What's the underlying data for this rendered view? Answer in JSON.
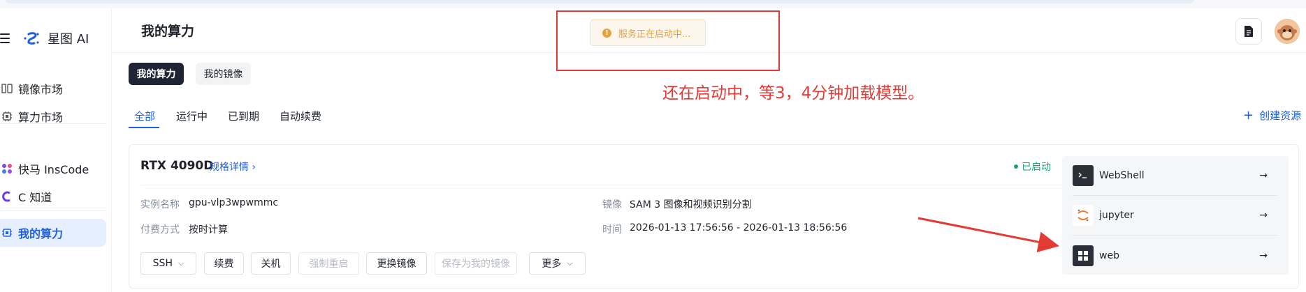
{
  "brand": {
    "name": "星图 AI"
  },
  "sidebar": {
    "items": [
      {
        "label": "镜像市场",
        "icon": "image-market-icon"
      },
      {
        "label": "算力市场",
        "icon": "compute-market-icon"
      },
      {
        "label": "快马 InsCode",
        "icon": "inscode-icon"
      },
      {
        "label": "C 知道",
        "icon": "c-zhidao-icon"
      },
      {
        "label": "我的算力",
        "icon": "my-compute-icon",
        "active": true
      }
    ]
  },
  "header": {
    "title": "我的算力"
  },
  "toast": {
    "message": "服务正在启动中..."
  },
  "annotation": {
    "text": "还在启动中，等3，4分钟加载模型。"
  },
  "segments": [
    {
      "label": "我的算力",
      "active": true
    },
    {
      "label": "我的镜像",
      "active": false
    }
  ],
  "tabs": [
    {
      "label": "全部",
      "active": true
    },
    {
      "label": "运行中"
    },
    {
      "label": "已到期"
    },
    {
      "label": "自动续费"
    }
  ],
  "create_label": "创建资源",
  "instance": {
    "gpu": "RTX 4090D",
    "spec_link": "规格详情",
    "status": "已启动",
    "name_label": "实例名称",
    "name": "gpu-vlp3wpwmmc",
    "billing_label": "付费方式",
    "billing": "按时计算",
    "image_label": "镜像",
    "image": "SAM 3 图像和视频识别分割",
    "time_label": "时间",
    "time": "2026-01-13 17:56:56 - 2026-01-13 18:56:56",
    "actions": {
      "ssh": "SSH",
      "renew": "续费",
      "shutdown": "关机",
      "force_restart": "强制重启",
      "change_image": "更换镜像",
      "save_image": "保存为我的镜像",
      "more": "更多"
    },
    "links": [
      {
        "label": "WebShell",
        "icon": "terminal-icon"
      },
      {
        "label": "jupyter",
        "icon": "jupyter-icon"
      },
      {
        "label": "web",
        "icon": "web-app-icon"
      }
    ]
  },
  "colors": {
    "accent": "#1f5fe0",
    "annotation": "#e53935",
    "success": "#1aa36f",
    "warning": "#e6a23c"
  }
}
